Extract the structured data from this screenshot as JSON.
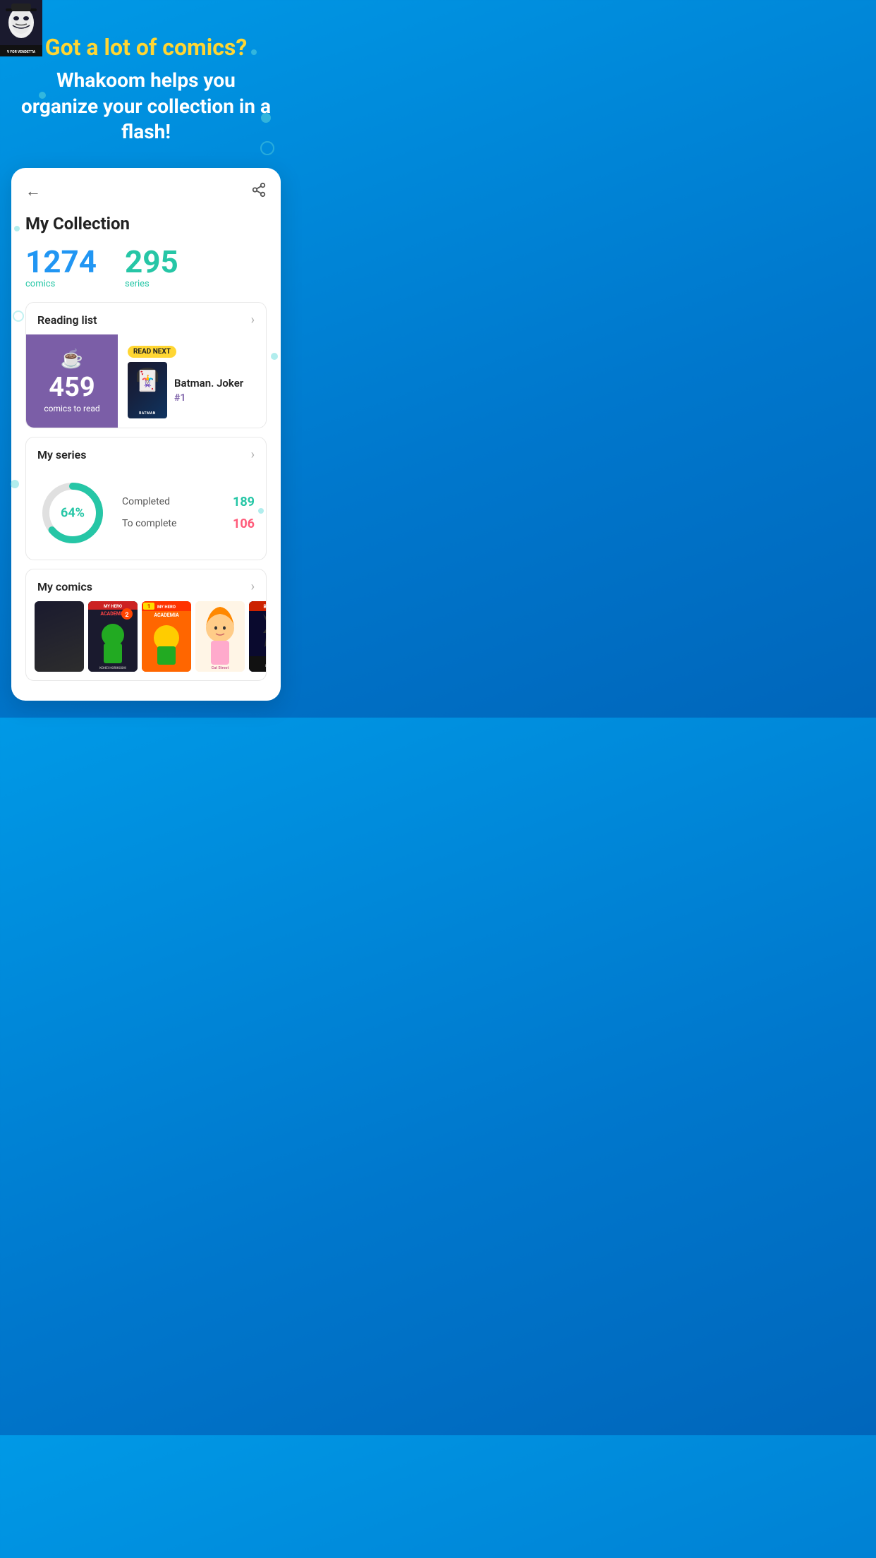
{
  "hero": {
    "title_yellow": "Got a lot of comics?",
    "title_white": "Whakoom helps you organize your collection in a flash!"
  },
  "card": {
    "back_label": "←",
    "share_label": "⤴",
    "title": "My Collection",
    "stats": {
      "comics_count": "1274",
      "comics_label": "comics",
      "series_count": "295",
      "series_label": "series"
    },
    "reading_list": {
      "section_title": "Reading list",
      "count": "459",
      "count_label": "comics to read",
      "badge": "READ NEXT",
      "comic_name": "Batman. Joker",
      "comic_issue": "#1"
    },
    "my_series": {
      "section_title": "My series",
      "percent": "64%",
      "completed_label": "Completed",
      "completed_value": "189",
      "to_complete_label": "To complete",
      "to_complete_value": "106"
    },
    "my_comics": {
      "section_title": "My comics",
      "covers": [
        {
          "label": "V FOR VENDETTA",
          "theme": "v"
        },
        {
          "label": "MY HERO ACADEMIA",
          "theme": "mha1"
        },
        {
          "label": "MY HERO ACADEMIA",
          "theme": "mha2"
        },
        {
          "label": "CAT STREET",
          "theme": "cat"
        },
        {
          "label": "BATMAN",
          "theme": "batman2"
        }
      ]
    }
  }
}
